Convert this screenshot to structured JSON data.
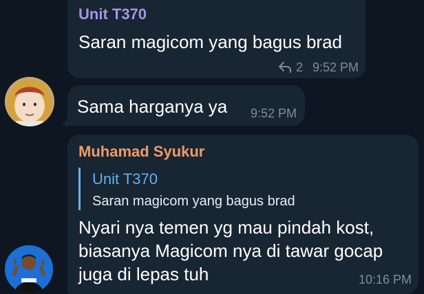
{
  "messages": [
    {
      "sender": "Unit T370",
      "text": "Saran magicom yang bagus brad",
      "reply_count": "2",
      "time": "9:52 PM"
    },
    {
      "text": "Sama harganya ya",
      "time": "9:52 PM"
    },
    {
      "sender": "Muhamad Syukur",
      "quote": {
        "sender": "Unit T370",
        "text": "Saran magicom yang bagus brad"
      },
      "lines": [
        "Nyari nya temen yg mau pindah kost,",
        "biasanya Magicom nya di tawar gocap",
        "juga di lepas tuh"
      ],
      "time": "10:16 PM"
    }
  ],
  "colors": {
    "background": "#0e1621",
    "bubble": "#182533",
    "sender1": "#a695e7",
    "sender2": "#ef9b66",
    "quote_accent": "#6ab3f3",
    "meta": "#7f8c99"
  },
  "icons": {
    "reply": "reply-arrow-icon"
  }
}
